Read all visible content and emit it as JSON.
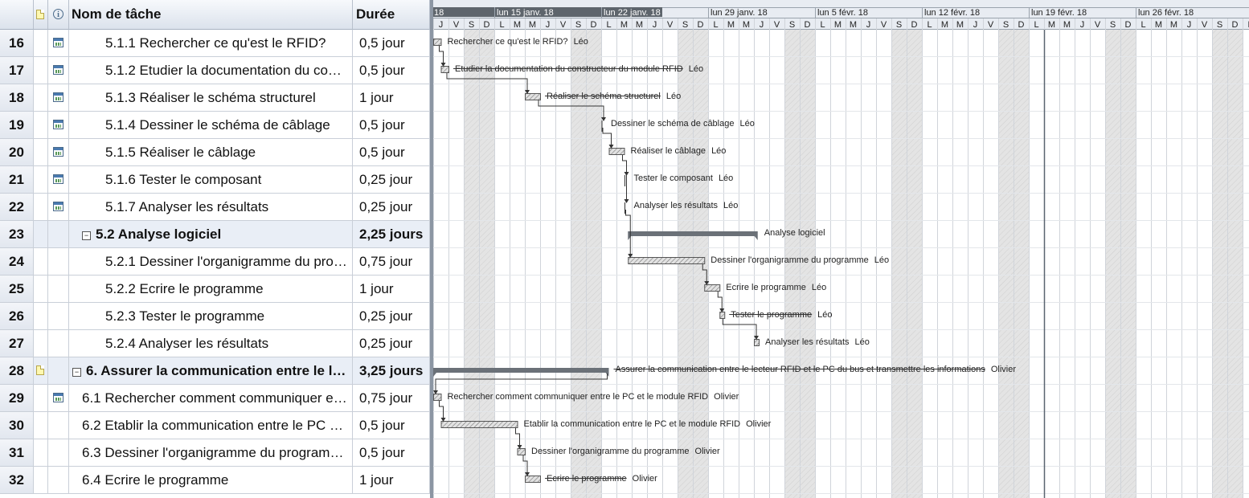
{
  "columns": {
    "name_header": "Nom de tâche",
    "duration_header": "Durée",
    "note_header_icon": "note-icon",
    "info_header_icon": "info-icon"
  },
  "tasks": [
    {
      "id": "16",
      "name": "5.1.1 Rechercher ce qu'est le RFID?",
      "duration": "0,5 jour",
      "summary": false,
      "level": 2,
      "calendar": true,
      "note": false
    },
    {
      "id": "17",
      "name": "5.1.2 Etudier la documentation du constructeur du module RFID",
      "duration": "0,5 jour",
      "summary": false,
      "level": 2,
      "calendar": true,
      "note": false
    },
    {
      "id": "18",
      "name": "5.1.3 Réaliser le schéma structurel",
      "duration": "1 jour",
      "summary": false,
      "level": 2,
      "calendar": true,
      "note": false
    },
    {
      "id": "19",
      "name": "5.1.4 Dessiner le schéma de câblage",
      "duration": "0,5 jour",
      "summary": false,
      "level": 2,
      "calendar": true,
      "note": false
    },
    {
      "id": "20",
      "name": "5.1.5 Réaliser le câblage",
      "duration": "0,5 jour",
      "summary": false,
      "level": 2,
      "calendar": true,
      "note": false
    },
    {
      "id": "21",
      "name": "5.1.6 Tester le composant",
      "duration": "0,25 jour",
      "summary": false,
      "level": 2,
      "calendar": true,
      "note": false
    },
    {
      "id": "22",
      "name": "5.1.7 Analyser les résultats",
      "duration": "0,25 jour",
      "summary": false,
      "level": 2,
      "calendar": true,
      "note": false
    },
    {
      "id": "23",
      "name": "5.2 Analyse logiciel",
      "duration": "2,25 jours",
      "summary": true,
      "level": 1,
      "calendar": false,
      "note": false
    },
    {
      "id": "24",
      "name": "5.2.1 Dessiner l'organigramme du programme",
      "duration": "0,75 jour",
      "summary": false,
      "level": 2,
      "calendar": false,
      "note": false
    },
    {
      "id": "25",
      "name": "5.2.2 Ecrire le programme",
      "duration": "1 jour",
      "summary": false,
      "level": 2,
      "calendar": false,
      "note": false
    },
    {
      "id": "26",
      "name": "5.2.3 Tester le programme",
      "duration": "0,25 jour",
      "summary": false,
      "level": 2,
      "calendar": false,
      "note": false
    },
    {
      "id": "27",
      "name": "5.2.4 Analyser les résultats",
      "duration": "0,25 jour",
      "summary": false,
      "level": 2,
      "calendar": false,
      "note": false
    },
    {
      "id": "28",
      "name": "6. Assurer la communication entre le lecteur RFID et le PC du bus et transmettre les informations",
      "duration": "3,25 jours",
      "summary": true,
      "level": 0,
      "calendar": false,
      "note": true
    },
    {
      "id": "29",
      "name": "6.1 Rechercher comment communiquer entre le PC et le module RFID",
      "duration": "0,75 jour",
      "summary": false,
      "level": 1,
      "calendar": true,
      "note": false
    },
    {
      "id": "30",
      "name": "6.2 Etablir la communication entre le PC et le module RFID",
      "duration": "0,5 jour",
      "summary": false,
      "level": 1,
      "calendar": false,
      "note": false
    },
    {
      "id": "31",
      "name": "6.3 Dessiner l'organigramme du programme",
      "duration": "0,5 jour",
      "summary": false,
      "level": 1,
      "calendar": false,
      "note": false
    },
    {
      "id": "32",
      "name": "6.4 Ecrire le programme",
      "duration": "1 jour",
      "summary": false,
      "level": 1,
      "calendar": false,
      "note": false
    }
  ],
  "timescale": {
    "first_partial_week_label": "18",
    "weeks": [
      "lun 15 janv. 18",
      "lun 22 janv. 18",
      "lun 29 janv. 18",
      "lun 5 févr. 18",
      "lun 12 févr. 18",
      "lun 19 févr. 18",
      "lun 26 févr. 18"
    ],
    "day_letters": [
      "J",
      "V",
      "S",
      "D",
      "L",
      "M",
      "M",
      "J",
      "V",
      "S",
      "D",
      "L",
      "M",
      "M",
      "J",
      "V",
      "S",
      "D",
      "L",
      "M",
      "M",
      "J",
      "V",
      "S",
      "D",
      "L",
      "M",
      "M",
      "J",
      "V",
      "S",
      "D",
      "L",
      "M",
      "M",
      "J",
      "V",
      "S",
      "D",
      "L",
      "M",
      "M",
      "J",
      "V",
      "S",
      "D",
      "L",
      "M",
      "M",
      "J",
      "V",
      "S",
      "D",
      "L",
      "M",
      "M"
    ],
    "first_day": "2018-01-11",
    "non_working_day_letters": [
      "S",
      "D"
    ],
    "status_date": "2018-02-20"
  },
  "gantt_bars": [
    {
      "task": "16",
      "kind": "task",
      "start": 0.0,
      "end": 0.5,
      "label": "Rechercher ce qu'est le RFID?",
      "resource": "Léo",
      "strike": false
    },
    {
      "task": "17",
      "kind": "task",
      "start": 0.5,
      "end": 1.0,
      "label": "Etudier la documentation du constructeur du module RFID",
      "resource": "Léo",
      "strike": true
    },
    {
      "task": "18",
      "kind": "task",
      "start": 6.0,
      "end": 7.0,
      "label": "Réaliser le schéma structurel",
      "resource": "Léo",
      "strike": true
    },
    {
      "task": "19",
      "kind": "milestone-line",
      "start": 11.0,
      "end": 11.0,
      "label": "Dessiner le schéma de câblage",
      "resource": "Léo",
      "strike": false
    },
    {
      "task": "20",
      "kind": "task",
      "start": 11.5,
      "end": 12.5,
      "label": "Réaliser le câblage",
      "resource": "Léo",
      "strike": false
    },
    {
      "task": "21",
      "kind": "milestone-line",
      "start": 12.5,
      "end": 12.5,
      "label": "Tester le composant",
      "resource": "Léo",
      "strike": false
    },
    {
      "task": "22",
      "kind": "milestone-line",
      "start": 12.5,
      "end": 12.5,
      "label": "Analyser les résultats",
      "resource": "Léo",
      "strike": false
    },
    {
      "task": "23",
      "kind": "summary",
      "start": 12.75,
      "end": 21.25,
      "label": "Analyse logiciel",
      "resource": "",
      "strike": false
    },
    {
      "task": "24",
      "kind": "task",
      "start": 12.75,
      "end": 17.75,
      "label": "Dessiner l'organigramme du programme",
      "resource": "Léo",
      "strike": false
    },
    {
      "task": "25",
      "kind": "task",
      "start": 17.75,
      "end": 18.75,
      "label": "Ecrire le programme",
      "resource": "Léo",
      "strike": false
    },
    {
      "task": "26",
      "kind": "task",
      "start": 18.75,
      "end": 19.0,
      "label": "Tester le programme",
      "resource": "Léo",
      "strike": true
    },
    {
      "task": "27",
      "kind": "task",
      "start": 21.0,
      "end": 21.25,
      "label": "Analyser les résultats",
      "resource": "Léo",
      "strike": false
    },
    {
      "task": "28",
      "kind": "summary",
      "start": 0.0,
      "end": 11.5,
      "label": "Assurer la communication entre le lecteur RFID et le PC du bus et transmettre les informations",
      "resource": "Olivier",
      "strike": true
    },
    {
      "task": "29",
      "kind": "task",
      "start": 0.0,
      "end": 0.5,
      "label": "Rechercher comment communiquer entre le PC et le module RFID",
      "resource": "Olivier",
      "strike": false
    },
    {
      "task": "30",
      "kind": "task",
      "start": 0.5,
      "end": 5.5,
      "label": "Etablir la communication entre le PC et le module RFID",
      "resource": "Olivier",
      "strike": false
    },
    {
      "task": "31",
      "kind": "task",
      "start": 5.5,
      "end": 6.0,
      "label": "Dessiner l'organigramme du programme",
      "resource": "Olivier",
      "strike": false
    },
    {
      "task": "32",
      "kind": "task",
      "start": 6.0,
      "end": 7.0,
      "label": "Ecrire le programme",
      "resource": "Olivier",
      "strike": true
    }
  ],
  "colors": {
    "summary_bar": "#6b7178",
    "task_fill": "#c8c8c8",
    "task_border": "#555555",
    "weekend_shade": "#d6d6d6",
    "timescale_top": "#e8ecf2",
    "link": "#333333",
    "status_line": "#5a6470"
  }
}
